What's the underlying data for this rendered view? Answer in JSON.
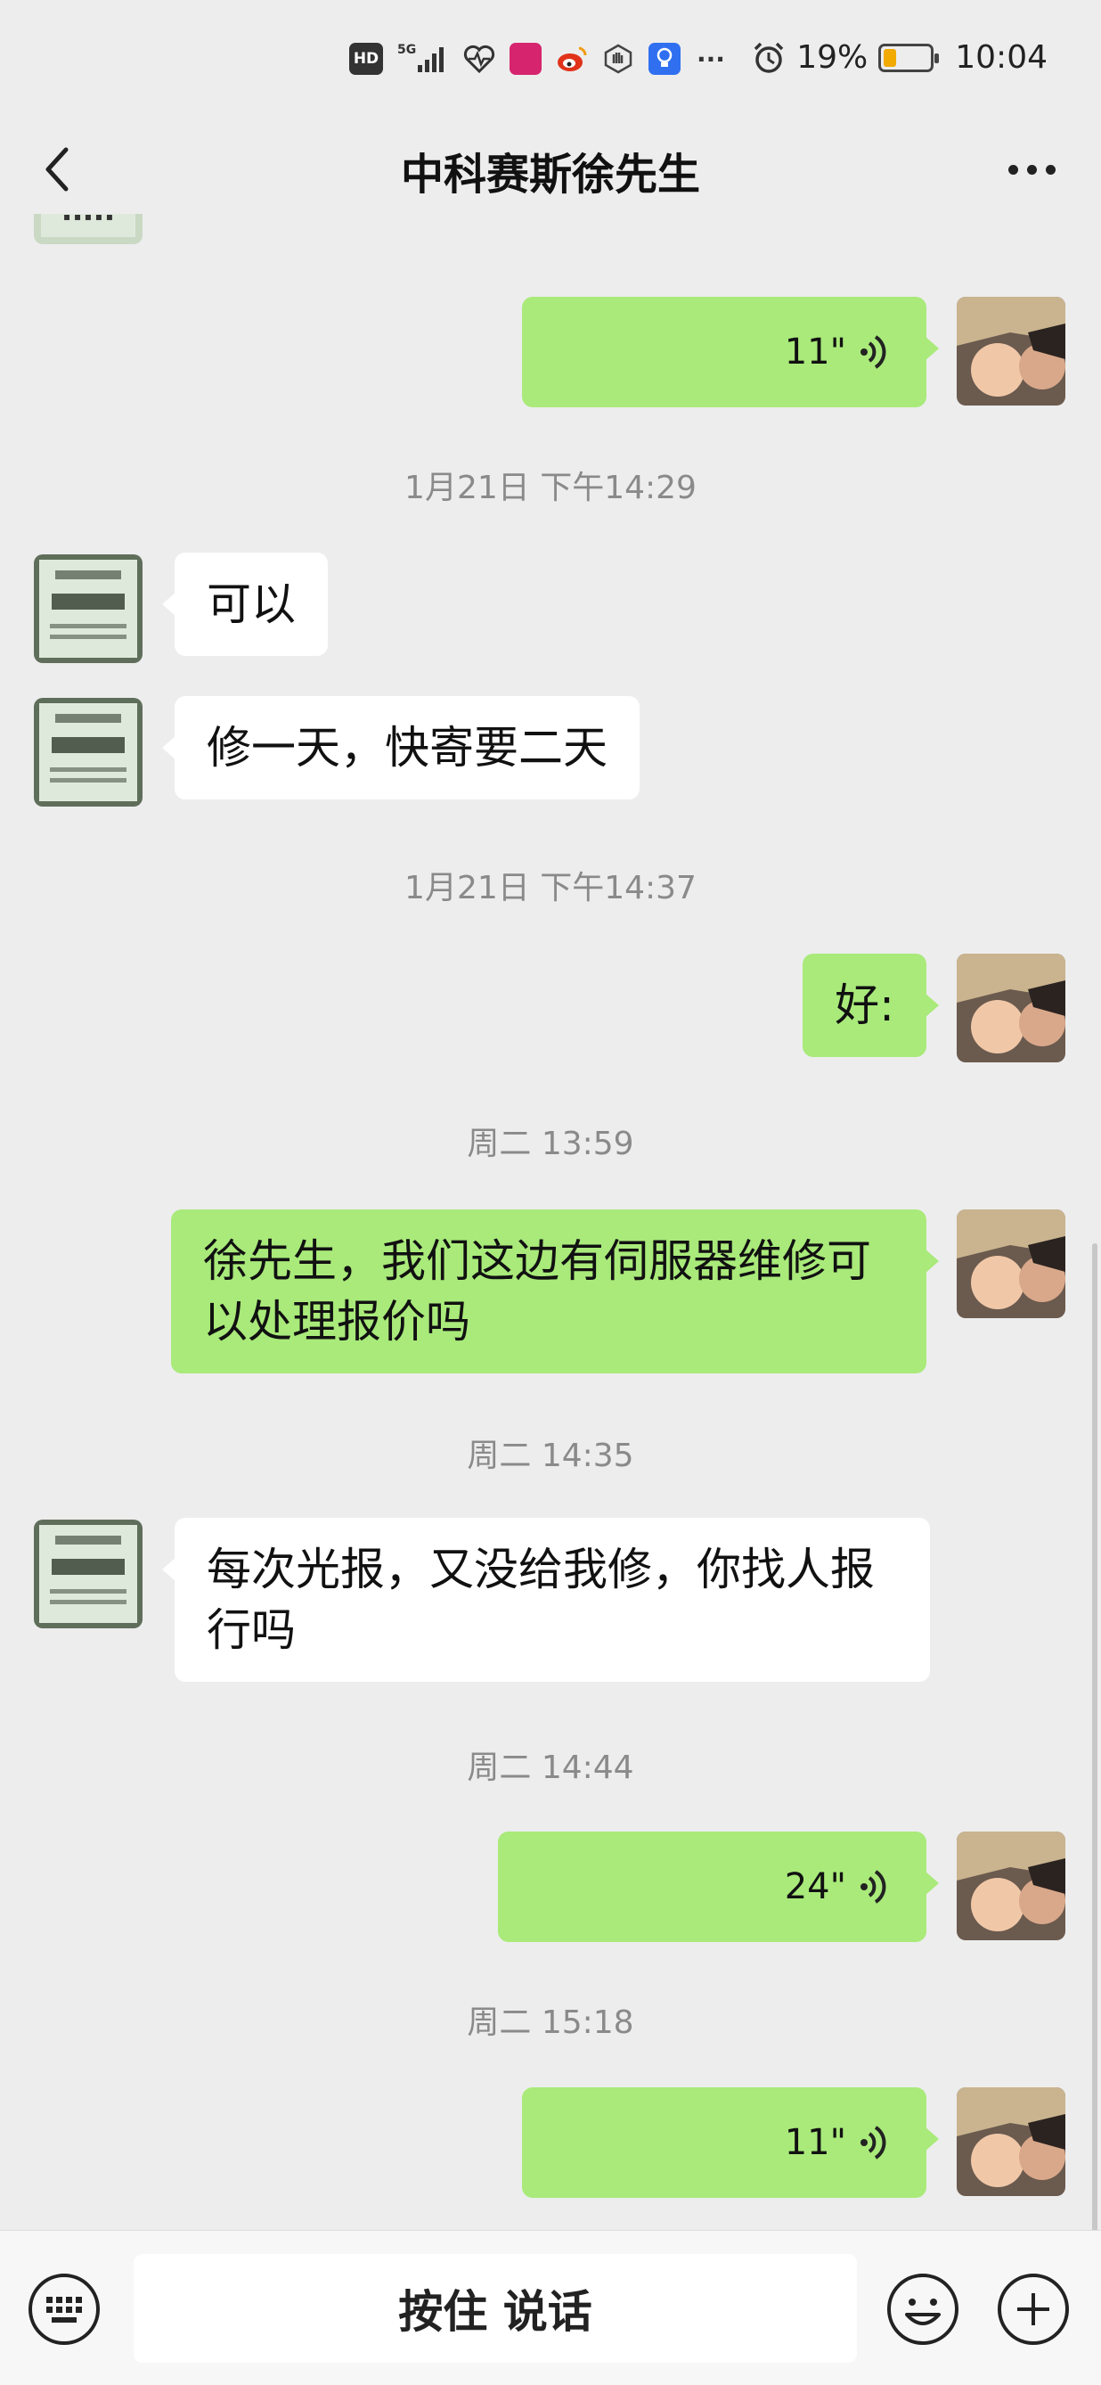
{
  "status_bar": {
    "hd": "HD",
    "network": "5G",
    "battery_percent": "19%",
    "battery_level": 0.19,
    "time": "10:04",
    "icons": [
      "hd-icon",
      "signal-icon",
      "health-icon",
      "app-badge-icon",
      "weibo-icon",
      "hand-icon",
      "light-bulb-icon",
      "more-notifications-icon",
      "alarm-icon",
      "battery-icon"
    ]
  },
  "nav": {
    "title": "中科赛斯徐先生",
    "back_icon": "chevron-left-icon",
    "more_icon": "more-dots-icon"
  },
  "messages": [
    {
      "type": "voice",
      "side": "right",
      "duration": "11\""
    },
    {
      "type": "time",
      "text": "1月21日 下午14:29"
    },
    {
      "type": "text",
      "side": "left",
      "text": "可以"
    },
    {
      "type": "text",
      "side": "left",
      "text": "修一天，快寄要二天"
    },
    {
      "type": "time",
      "text": "1月21日 下午14:37"
    },
    {
      "type": "text",
      "side": "right",
      "text": "好:"
    },
    {
      "type": "time",
      "text": "周二 13:59"
    },
    {
      "type": "text",
      "side": "right",
      "text": "徐先生，我们这边有伺服器维修可以处理报价吗"
    },
    {
      "type": "time",
      "text": "周二 14:35"
    },
    {
      "type": "text",
      "side": "left",
      "text": "每次光报，又没给我修，你找人报行吗"
    },
    {
      "type": "time",
      "text": "周二 14:44"
    },
    {
      "type": "voice",
      "side": "right",
      "duration": "24\""
    },
    {
      "type": "time",
      "text": "周二 15:18"
    },
    {
      "type": "voice",
      "side": "right",
      "duration": "11\""
    }
  ],
  "input_bar": {
    "hold_to_talk": "按住 说话",
    "keyboard_icon": "keyboard-icon",
    "emoji_icon": "emoji-icon",
    "plus_icon": "plus-icon"
  },
  "colors": {
    "background": "#ededed",
    "bubble_self": "#a9ea7a",
    "bubble_other": "#ffffff",
    "timestamp": "#8a8a8a"
  }
}
